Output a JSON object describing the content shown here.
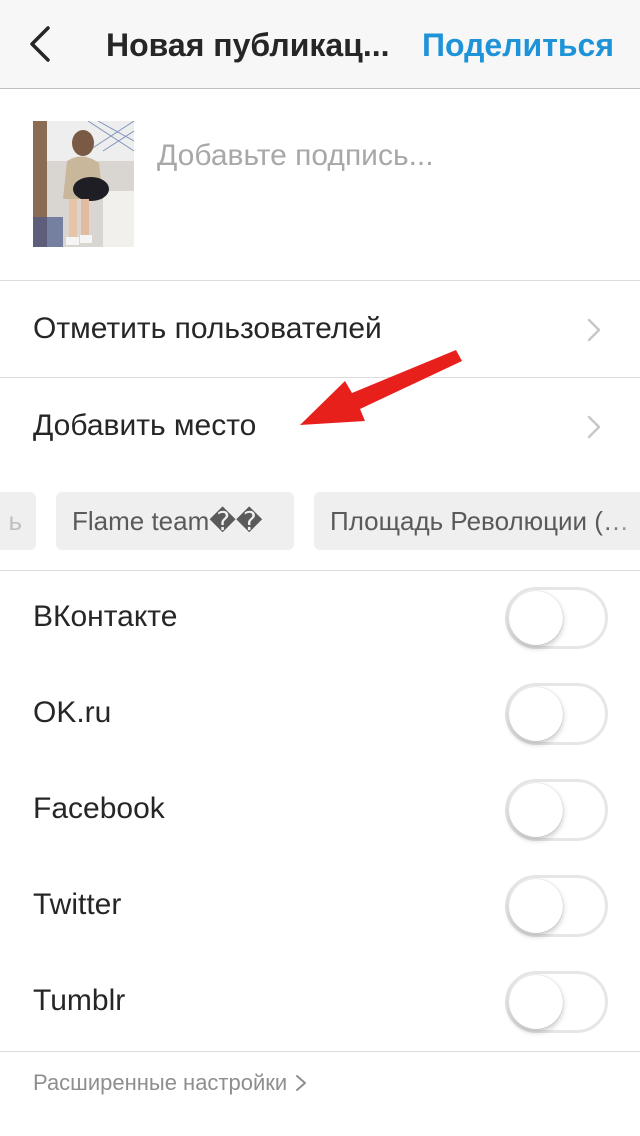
{
  "navbar": {
    "back_icon": "chevron-left-icon",
    "title": "Новая публикац...",
    "share_label": "Поделиться",
    "accent_color": "#1f93d8"
  },
  "caption": {
    "placeholder": "Добавьте подпись...",
    "value": ""
  },
  "menu": {
    "tag_people": "Отметить пользователей",
    "add_location": "Добавить место"
  },
  "locations": {
    "partial_chip": "ь",
    "chip_1": "Flame team��",
    "chip_2": "Площадь Революции (…"
  },
  "share_to": [
    {
      "label": "ВКонтакте",
      "enabled": false
    },
    {
      "label": "OK.ru",
      "enabled": false
    },
    {
      "label": "Facebook",
      "enabled": false
    },
    {
      "label": "Twitter",
      "enabled": false
    },
    {
      "label": "Tumblr",
      "enabled": false
    }
  ],
  "advanced_settings": "Расширенные настройки",
  "annotation_color": "#e8201c"
}
